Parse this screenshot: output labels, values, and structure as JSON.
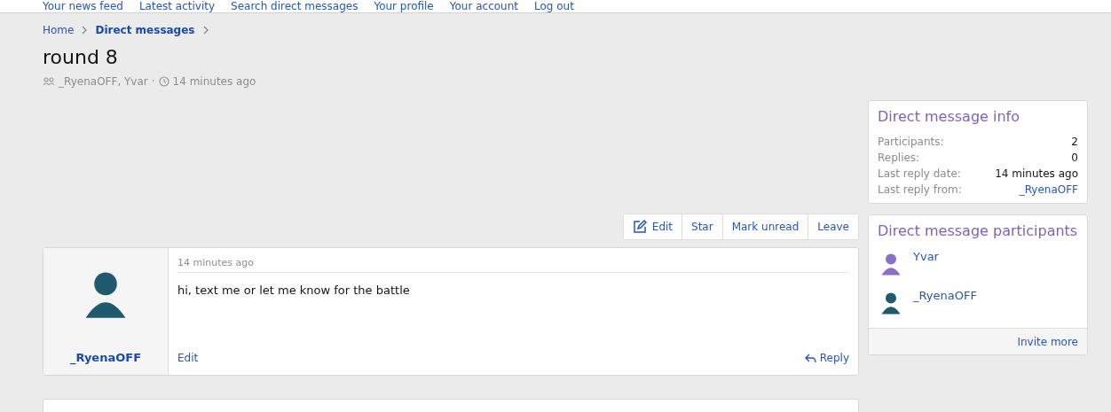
{
  "nav": [
    "Your news feed",
    "Latest activity",
    "Search direct messages",
    "Your profile",
    "Your account",
    "Log out"
  ],
  "breadcrumbs": [
    {
      "label": "Home",
      "current": false
    },
    {
      "label": "Direct messages",
      "current": true
    }
  ],
  "title": "round 8",
  "meta": {
    "participants": "_RyenaOFF, Yvar",
    "separator": "·",
    "time": "14 minutes ago"
  },
  "actions": [
    {
      "label": "Edit",
      "kind": "icon"
    },
    {
      "label": "Star",
      "kind": "plain"
    },
    {
      "label": "Mark unread",
      "kind": "plain"
    },
    {
      "label": "Leave",
      "kind": "plain"
    }
  ],
  "messages": [
    {
      "author": "_RyenaOFF",
      "color": "#1f5a6e",
      "time": "14 minutes ago",
      "body": "hi, text me or let me know for the battle",
      "edit": "Edit",
      "reply": "Reply"
    }
  ],
  "info": {
    "title": "Direct message info",
    "rows": [
      {
        "label": "Participants:",
        "value": "2",
        "kind": "text"
      },
      {
        "label": "Replies:",
        "value": "0",
        "kind": "text"
      },
      {
        "label": "Last reply date:",
        "value": "14 minutes ago",
        "kind": "text"
      },
      {
        "label": "Last reply from:",
        "value": "_RyenaOFF",
        "kind": "link"
      }
    ]
  },
  "participants": {
    "title": "Direct message participants",
    "items": [
      {
        "name": "Yvar",
        "color": "#8a6fc4"
      },
      {
        "name": "_RyenaOFF",
        "color": "#1f5a6e"
      }
    ],
    "footer": "Invite more"
  }
}
